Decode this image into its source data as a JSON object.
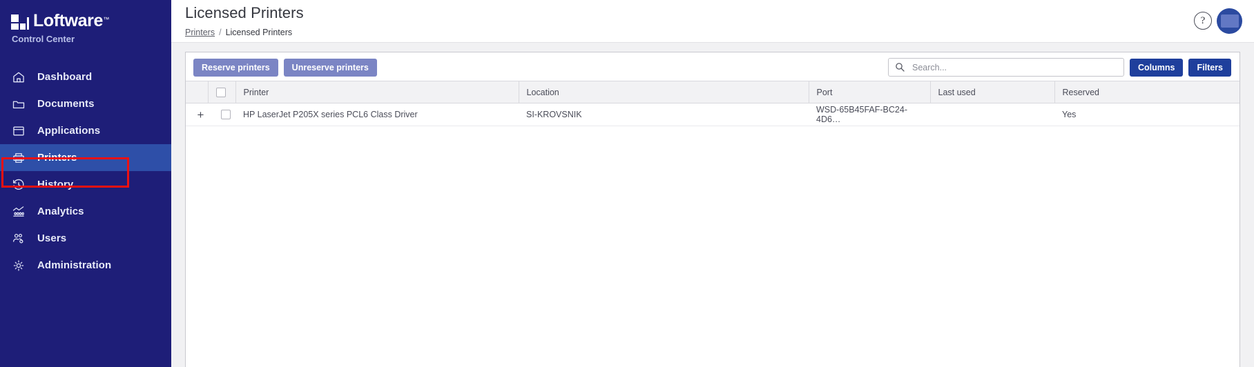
{
  "sidebar": {
    "brand": {
      "name": "Loftware",
      "trademark": "™",
      "subtitle": "Control Center",
      "logo_icon": "loftware-blocks-logo"
    },
    "items": [
      {
        "label": "Dashboard",
        "icon": "home-icon",
        "active": false
      },
      {
        "label": "Documents",
        "icon": "folder-icon",
        "active": false
      },
      {
        "label": "Applications",
        "icon": "window-icon",
        "active": false
      },
      {
        "label": "Printers",
        "icon": "printer-icon",
        "active": true
      },
      {
        "label": "History",
        "icon": "history-icon",
        "active": false
      },
      {
        "label": "Analytics",
        "icon": "analytics-icon",
        "active": false
      },
      {
        "label": "Users",
        "icon": "users-icon",
        "active": false
      },
      {
        "label": "Administration",
        "icon": "gear-icon",
        "active": false
      }
    ]
  },
  "header": {
    "title": "Licensed Printers",
    "breadcrumb": {
      "parent": "Printers",
      "separator": "/",
      "current": "Licensed Printers"
    },
    "help_icon": "question-mark-icon",
    "help_label": "?",
    "avatar_icon": "user-avatar"
  },
  "toolbar": {
    "reserve_label": "Reserve printers",
    "unreserve_label": "Unreserve printers",
    "search": {
      "value": "",
      "placeholder": "Search...",
      "icon": "search-icon"
    },
    "columns_label": "Columns",
    "filters_label": "Filters"
  },
  "table": {
    "columns": [
      "Printer",
      "Location",
      "Port",
      "Last used",
      "Reserved"
    ],
    "select_all_icon": "checkbox-unchecked",
    "rows": [
      {
        "expander": "+",
        "checkbox": "checkbox-unchecked",
        "printer": "HP LaserJet P205X series PCL6 Class Driver",
        "location": "SI-KROVSNIK",
        "port": "WSD-65B45FAF-BC24-4D6…",
        "last_used": "",
        "reserved": "Yes"
      }
    ]
  },
  "colors": {
    "sidebar_bg": "#1e1e78",
    "sidebar_active": "#2e4fa8",
    "focus_outline": "#ee1111",
    "primary_button": "#1f3f9c",
    "disabled_button": "#7b85c4",
    "avatar_bg": "#2b4aa0"
  }
}
